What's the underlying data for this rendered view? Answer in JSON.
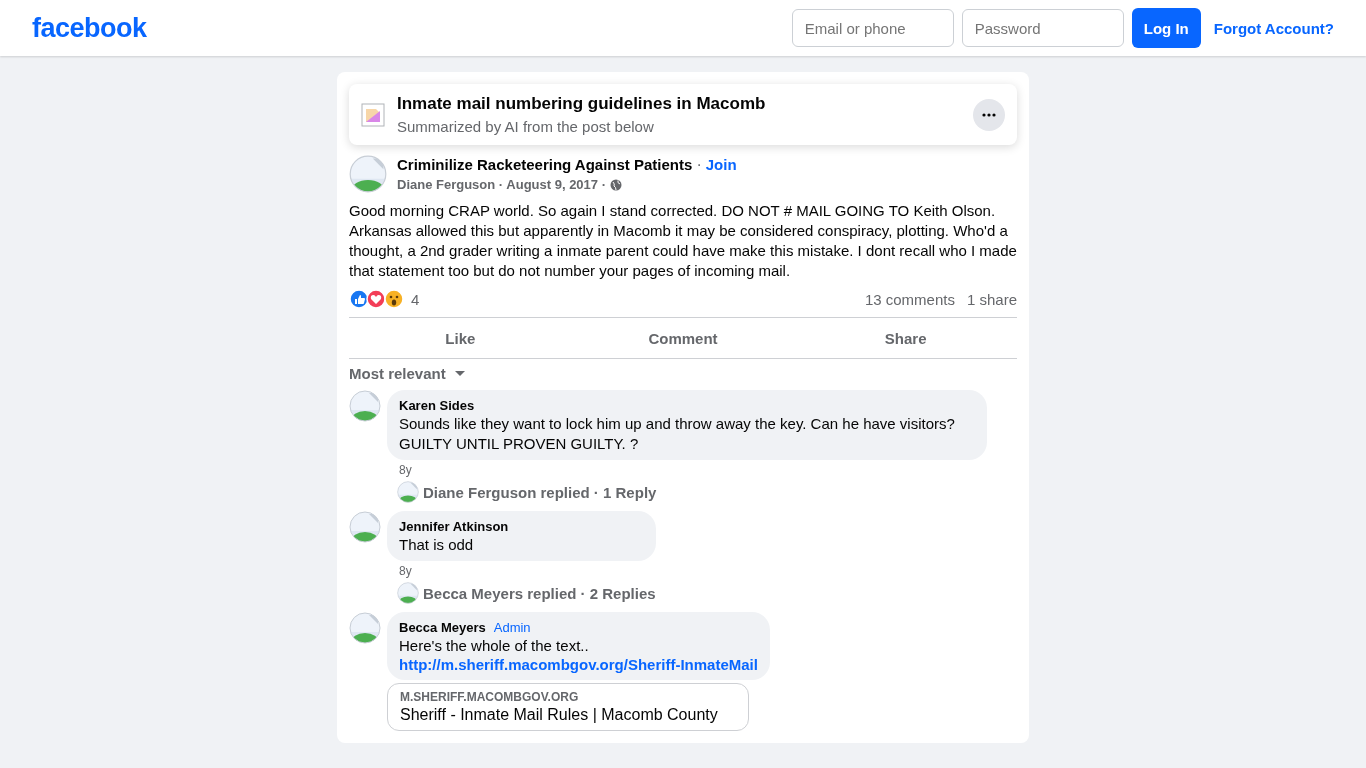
{
  "header": {
    "logo": "facebook",
    "email_placeholder": "Email or phone",
    "password_placeholder": "Password",
    "login": "Log In",
    "forgot": "Forgot Account?"
  },
  "summary": {
    "title": "Inmate mail numbering guidelines in Macomb",
    "subtitle": "Summarized by AI from the post below"
  },
  "post": {
    "group": "Criminilize Racketeering Against Patients",
    "separator": "·",
    "join": "Join",
    "meta": "Diane Ferguson · August 9, 2017 ·",
    "text": "Good morning CRAP world. So again I stand corrected. DO NOT # MAIL GOING TO Keith Olson. Arkansas allowed this but apparently in Macomb it may be considered conspiracy, plotting. Who'd a thought, a 2nd grader writing a inmate parent could have make this mistake. I dont recall who I made that statement too but do not number your pages of incoming mail.",
    "reaction_count": "4",
    "comments_count": "13 comments",
    "shares_count": "1 share",
    "actions": [
      "Like",
      "Comment",
      "Share"
    ],
    "sort": "Most relevant"
  },
  "comments": [
    {
      "author": "Karen Sides",
      "text": "Sounds like they want to lock him up and throw away the key. Can he have visitors? GUILTY UNTIL PROVEN GUILTY. ?",
      "time": "8y",
      "replies": "Diane Ferguson replied · 1 Reply"
    },
    {
      "author": "Jennifer Atkinson",
      "text": "That is odd",
      "time": "8y",
      "replies": "Becca Meyers replied · 2 Replies"
    },
    {
      "author": "Becca Meyers",
      "badge": "Admin",
      "text": "Here's the whole of the text..",
      "link": "http://m.sheriff.macombgov.org/Sheriff-InmateMail",
      "preview": {
        "domain": "M.SHERIFF.MACOMBGOV.ORG",
        "title": "Sheriff - Inmate Mail Rules | Macomb County"
      }
    }
  ]
}
